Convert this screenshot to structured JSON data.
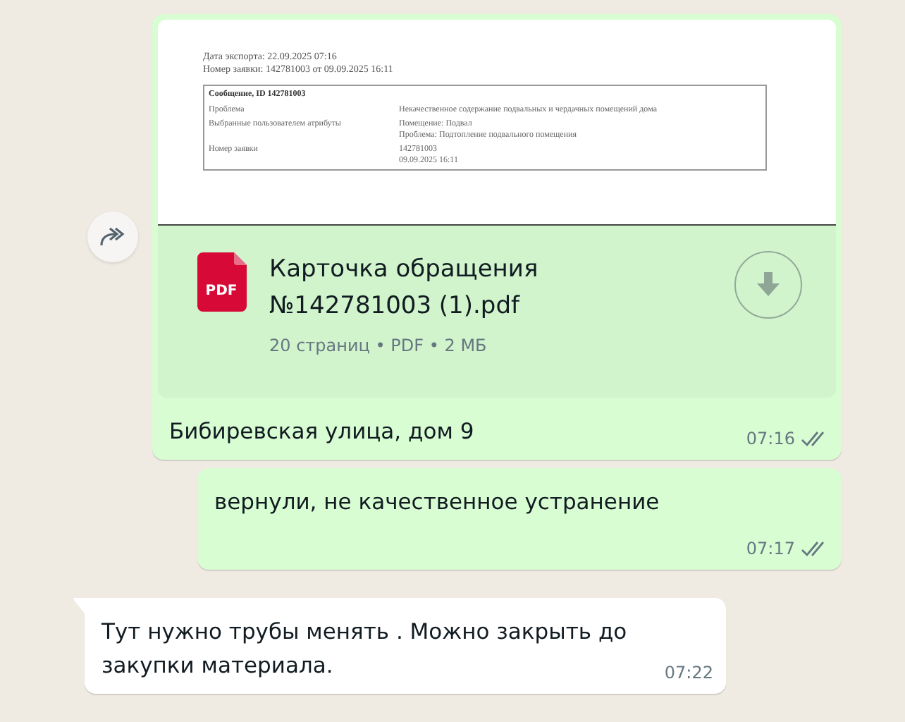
{
  "messages": [
    {
      "kind": "document",
      "outgoing": true,
      "forwardable": true,
      "preview": {
        "lines": [
          "Дата экспорта: 22.09.2025 07:16",
          "Номер заявки: 142781003 от 09.09.2025 16:11"
        ],
        "table_title": "Сообщение, ID 142781003",
        "rows": [
          {
            "label": "Проблема",
            "value": "Некачественное содержание подвальных и чердачных помещений дома"
          },
          {
            "label": "Выбранные пользователем атрибуты",
            "value": "Помещение: Подвал\nПроблема: Подтопление подвального помещения"
          },
          {
            "label": "Номер заявки",
            "value": "142781003\n09.09.2025 16:11"
          }
        ]
      },
      "file": {
        "icon_label": "PDF",
        "name": "Карточка обращения №142781003 (1).pdf",
        "meta": "20 страниц • PDF • 2 МБ"
      },
      "caption": "Бибиревская улица, дом 9",
      "time": "07:16",
      "read": false
    },
    {
      "kind": "text",
      "outgoing": true,
      "text": "вернули, не качественное устранение",
      "time": "07:17",
      "read": false
    },
    {
      "kind": "text",
      "outgoing": false,
      "tail": true,
      "text": "Тут нужно трубы менять . Можно закрыть до закупки материала.",
      "time": "07:22"
    }
  ]
}
